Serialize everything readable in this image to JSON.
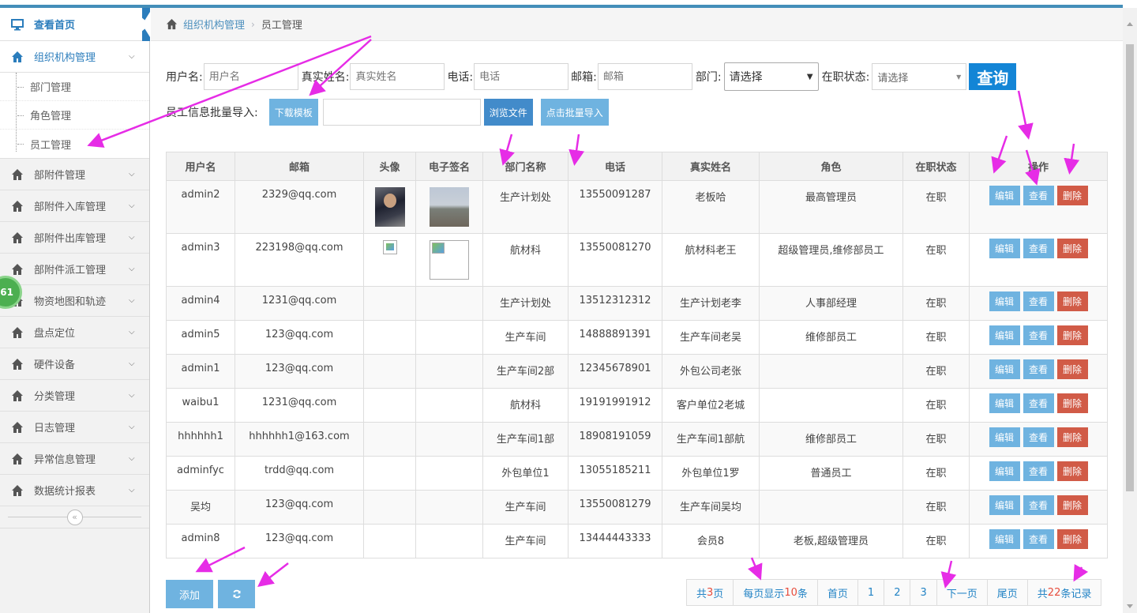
{
  "breadcrumb": {
    "home": "组织机构管理",
    "current": "员工管理"
  },
  "sidebar": {
    "home": "查看首页",
    "active_group": "组织机构管理",
    "sub_items": [
      "部门管理",
      "角色管理",
      "员工管理"
    ],
    "groups": [
      "部附件管理",
      "部附件入库管理",
      "部附件出库管理",
      "部附件派工管理",
      "物资地图和轨迹",
      "盘点定位",
      "硬件设备",
      "分类管理",
      "日志管理",
      "异常信息管理",
      "数据统计报表"
    ],
    "badge": "61"
  },
  "filters": {
    "username_label": "用户名:",
    "username_placeholder": "用户名",
    "realname_label": "真实姓名:",
    "realname_placeholder": "真实姓名",
    "phone_label": "电话:",
    "phone_placeholder": "电话",
    "email_label": "邮箱:",
    "email_placeholder": "邮箱",
    "dept_label": "部门:",
    "dept_value": "请选择",
    "status_label": "在职状态:",
    "status_value": "请选择",
    "query_button": "查询"
  },
  "import": {
    "label": "员工信息批量导入:",
    "download_button": "下载模板",
    "browse_button": "浏览文件",
    "batch_button": "点击批量导入"
  },
  "table": {
    "headers": [
      "用户名",
      "邮箱",
      "头像",
      "电子签名",
      "部门名称",
      "电话",
      "真实姓名",
      "角色",
      "在职状态",
      "操作"
    ],
    "rows": [
      {
        "user": "admin2",
        "email": "2329@qq.com",
        "dept": "生产计划处",
        "phone": "13550091287",
        "name": "老板哈",
        "role": "最高管理员",
        "status": "在职"
      },
      {
        "user": "admin3",
        "email": "223198@qq.com",
        "dept": "航材科",
        "phone": "13550081270",
        "name": "航材科老王",
        "role": "超级管理员,维修部员工",
        "status": "在职"
      },
      {
        "user": "admin4",
        "email": "1231@qq.com",
        "dept": "生产计划处",
        "phone": "13512312312",
        "name": "生产计划老李",
        "role": "人事部经理",
        "status": "在职"
      },
      {
        "user": "admin5",
        "email": "123@qq.com",
        "dept": "生产车间",
        "phone": "14888891391",
        "name": "生产车间老吴",
        "role": "维修部员工",
        "status": "在职"
      },
      {
        "user": "admin1",
        "email": "123@qq.com",
        "dept": "生产车间2部",
        "phone": "12345678901",
        "name": "外包公司老张",
        "role": "",
        "status": "在职"
      },
      {
        "user": "waibu1",
        "email": "1231@qq.com",
        "dept": "航材科",
        "phone": "19191991912",
        "name": "客户单位2老城",
        "role": "",
        "status": "在职"
      },
      {
        "user": "hhhhhh1",
        "email": "hhhhhh1@163.com",
        "dept": "生产车间1部",
        "phone": "18908191059",
        "name": "生产车间1部航",
        "role": "维修部员工",
        "status": "在职"
      },
      {
        "user": "adminfyc",
        "email": "trdd@qq.com",
        "dept": "外包单位1",
        "phone": "13055185211",
        "name": "外包单位1罗",
        "role": "普通员工",
        "status": "在职"
      },
      {
        "user": "吴均",
        "email": "123@qq.com",
        "dept": "生产车间",
        "phone": "13550081279",
        "name": "生产车间吴均",
        "role": "",
        "status": "在职"
      },
      {
        "user": "admin8",
        "email": "123@qq.com",
        "dept": "生产车间",
        "phone": "13444443333",
        "name": "会员8",
        "role": "老板,超级管理员",
        "status": "在职"
      }
    ],
    "ops": {
      "edit": "编辑",
      "view": "查看",
      "delete": "删除"
    }
  },
  "bottom": {
    "add_button": "添加"
  },
  "pager": {
    "total_pages_prefix": "共",
    "total_pages": "3",
    "total_pages_suffix": " 页",
    "per_page_prefix": "每页显示",
    "per_page": "10",
    "per_page_suffix": "条",
    "first": "首页",
    "pages": [
      "1",
      "2",
      "3"
    ],
    "next": "下一页",
    "last": "尾页",
    "total_prefix": "共",
    "total": "22",
    "total_suffix": "条记录"
  },
  "colors": {
    "accent": "#438eb9",
    "button": "#6fb3e0",
    "delete": "#d15b47",
    "query": "#1385d6",
    "annotation_arrow": "#e62ce6"
  }
}
